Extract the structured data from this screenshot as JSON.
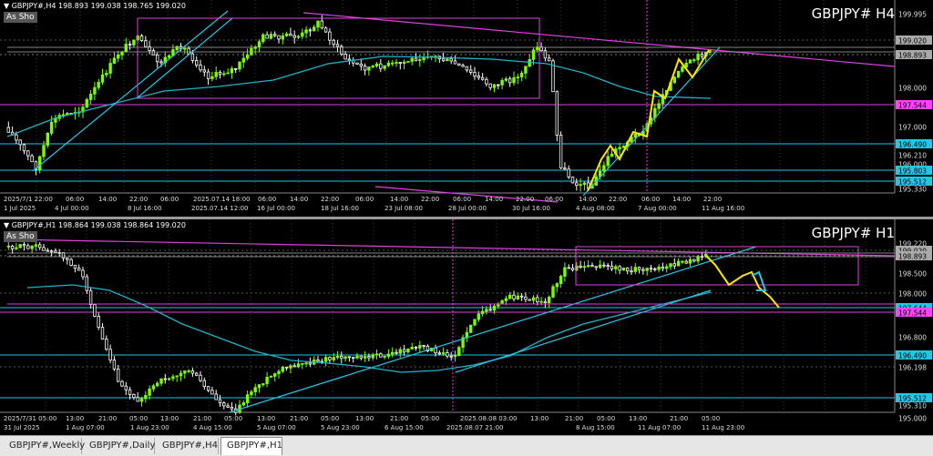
{
  "h4": {
    "ohlc": "▼ GBPJPY#,H4  198.893 199.038 198.765 199.020",
    "as_show": "As Sho",
    "title": "GBPJPY# H4",
    "price_labels": [
      "199.995",
      "199.020",
      "198.893",
      "198.000",
      "197.544",
      "197.000",
      "196.490",
      "196.210",
      "196.000",
      "195.803",
      "195.512",
      "195.330"
    ],
    "time_labels": [
      "2025/7/1 22:00",
      "06:00",
      "14:00",
      "22:00",
      "06:00",
      "2025.07.14 18:00",
      "06:00",
      "14:00",
      "22:00",
      "06:00",
      "14:00",
      "22:00",
      "06:00",
      "14:00",
      "22:00",
      "06:00",
      "14:00",
      "22:00",
      "06:00",
      "14:00",
      "22:00"
    ],
    "date_labels": [
      "1 Jul 2025",
      "4 Jul 00:00",
      "8 Jul 16:00",
      "2025.07.14 12:00",
      "16 Jul 00:00",
      "18 Jul 16:00",
      "23 Jul 08:00",
      "28 Jul 00:00",
      "30 Jul 16:00",
      "4 Aug 08:00",
      "7 Aug 00:00",
      "11 Aug 16:00"
    ]
  },
  "h1": {
    "ohlc": "▼ GBPJPY#,H1  198.864 199.038 198.864 199.020",
    "as_show": "As Sho",
    "title": "GBPJPY# H1",
    "price_labels": [
      "199.220",
      "199.020",
      "198.893",
      "198.500",
      "198.000",
      "197.644",
      "197.544",
      "196.800",
      "196.490",
      "196.198",
      "195.512",
      "195.310",
      "195.000"
    ],
    "time_labels": [
      "2025/7/31 05:00",
      "13:00",
      "21:00",
      "05:00",
      "13:00",
      "21:00",
      "05:00",
      "13:00",
      "21:00",
      "05:00",
      "13:00",
      "21:00",
      "05:00",
      "2025.08.08 03:00",
      "13:00",
      "21:00",
      "05:00",
      "13:00",
      "21:00",
      "05:00"
    ],
    "date_labels": [
      "31 Jul 2025",
      "1 Aug 07:00",
      "1 Aug 23:00",
      "4 Aug 15:00",
      "5 Aug 07:00",
      "5 Aug 23:00",
      "6 Aug 15:00",
      "2025.08.07 21:00",
      "8 Aug 15:00",
      "11 Aug 07:00",
      "11 Aug 23:00"
    ]
  },
  "tabs": [
    "GBPJPY#,Weekly",
    "GBPJPY#,Daily",
    "GBPJPY#,H4",
    "GBPJPY#,H1"
  ],
  "active_tab": "GBPJPY#,H1",
  "colors": {
    "up": "#7CFC00",
    "down": "#ffffff",
    "ma": "#20b2c8",
    "trend": "#20c8e8",
    "magenta": "#e040e0",
    "zigzag": "#ffe600"
  }
}
